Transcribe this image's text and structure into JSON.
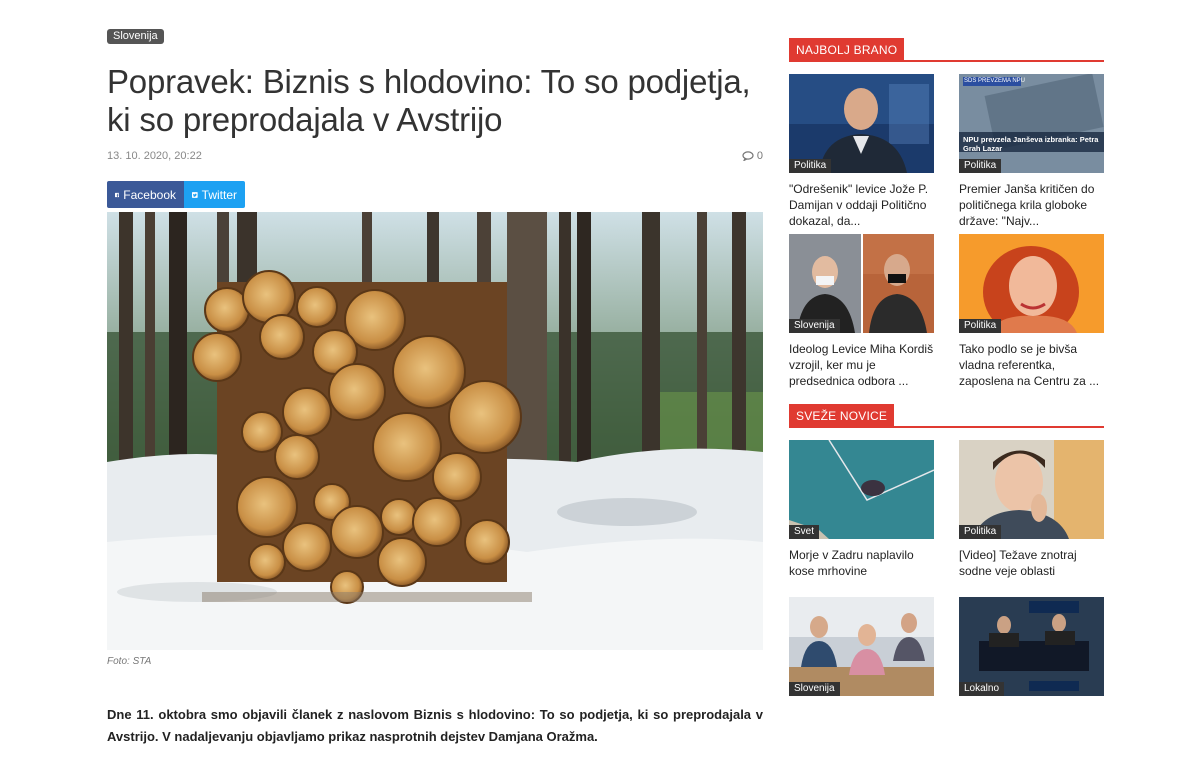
{
  "article": {
    "category": "Slovenija",
    "title": "Popravek: Biznis s hlodovino: To so podjetja, ki so preprodajala v Avstrijo",
    "date": "13. 10. 2020, 20:22",
    "comment_count": "0",
    "share": {
      "facebook": "Facebook",
      "twitter": "Twitter"
    },
    "photo_credit": "Foto: STA",
    "lead": "Dne 11. oktobra smo objavili članek z naslovom Biznis s hlodovino: To so podjetja, ki so preprodajala v Avstrijo. V nadaljevanju objavljamo prikaz nasprotnih dejstev Damjana Oražma."
  },
  "sidebar": {
    "most_read": {
      "heading": "NAJBOLJ BRANO",
      "items": [
        {
          "badge": "Politika",
          "title": "\"Odrešenik\" levice Jože P. Damijan v oddaji Politično dokazal, da..."
        },
        {
          "badge": "Politika",
          "title": "Premier Janša kritičen do političnega krila globoke države: \"Najv...",
          "overlay_tag": "SDS PREVZEMA NPU",
          "overlay_text": "NPU prevzela Janševa izbranka: Petra Grah Lazar"
        },
        {
          "badge": "Slovenija",
          "title": "Ideolog Levice Miha Kordiš vzrojil, ker mu je predsednica odbora ..."
        },
        {
          "badge": "Politika",
          "title": "Tako podlo se je bivša vladna referentka, zaposlena na Centru za ..."
        }
      ]
    },
    "fresh_news": {
      "heading": "SVEŽE NOVICE",
      "items": [
        {
          "badge": "Svet",
          "title": "Morje v Zadru naplavilo kose mrhovine"
        },
        {
          "badge": "Politika",
          "title": "[Video] Težave znotraj sodne veje oblasti"
        },
        {
          "badge": "Slovenija",
          "title": ""
        },
        {
          "badge": "Lokalno",
          "title": ""
        }
      ]
    }
  },
  "colors": {
    "accent": "#e03a31",
    "facebook": "#3b5998",
    "twitter": "#1da1f2"
  }
}
